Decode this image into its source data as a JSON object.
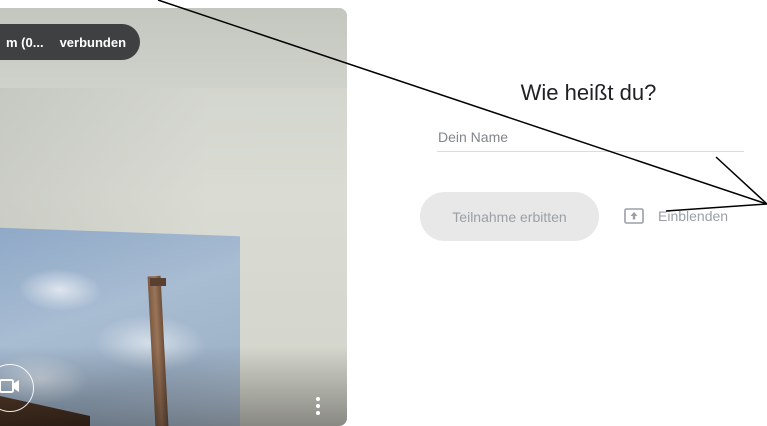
{
  "preview": {
    "participant_name": "m (0...",
    "connection_status": "verbunden",
    "camera_icon": "videocam-icon",
    "more_icon": "more-vert-icon"
  },
  "join": {
    "title": "Wie heißt du?",
    "name_placeholder": "Dein Name",
    "name_value": "",
    "ask_label": "Teilnahme erbitten",
    "present_label": "Einblenden",
    "present_icon": "present-to-all-icon"
  },
  "colors": {
    "ask_button_bg": "#e8e8e8",
    "disabled_text": "#9aa0a6",
    "title_text": "#202124",
    "annotation_line": "#000000"
  }
}
